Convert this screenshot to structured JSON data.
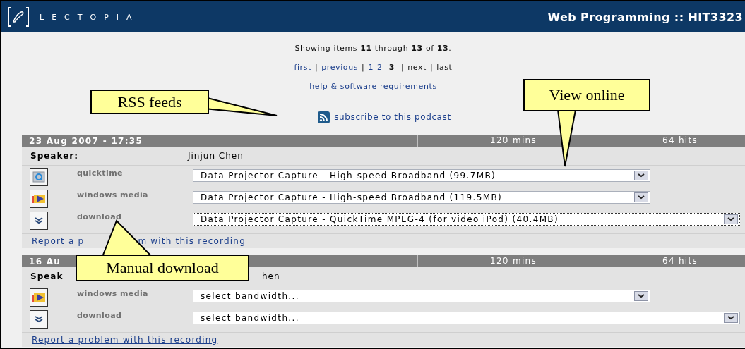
{
  "header": {
    "logo_text": "LECTOPIA",
    "title": "Web Programming :: HIT3323"
  },
  "paging": {
    "summary": "Showing items **11** through **13** of **13**.",
    "items": [
      {
        "text": "first",
        "kind": "link"
      },
      {
        "text": "|",
        "kind": "separator"
      },
      {
        "text": "previous",
        "kind": "link"
      },
      {
        "text": "|",
        "kind": "separator"
      },
      {
        "text": "1",
        "kind": "link"
      },
      {
        "text": "2",
        "kind": "link"
      },
      {
        "text": "3",
        "kind": "current"
      },
      {
        "text": "|",
        "kind": "separator"
      },
      {
        "text": "next",
        "kind": "plain"
      },
      {
        "text": "|",
        "kind": "separator"
      },
      {
        "text": "last",
        "kind": "plain"
      }
    ]
  },
  "help_link": "help & software requirements",
  "subscribe_link": "subscribe to this podcast",
  "recordings": [
    {
      "date": "23 Aug 2007 - 17:35",
      "duration": "120 mins",
      "hits": "64 hits",
      "speaker_label": "Speaker:",
      "speaker": "Jinjun Chen",
      "formats": [
        {
          "kind": "quicktime",
          "label": "quicktime",
          "value": "Data Projector Capture - High-speed Broadband (99.7MB)",
          "focused": false
        },
        {
          "kind": "windows_media",
          "label": "windows media",
          "value": "Data Projector Capture - High-speed Broadband (119.5MB)",
          "focused": false
        },
        {
          "kind": "download",
          "label": "download",
          "value": "Data Projector Capture - QuickTime MPEG-4 (for video iPod) (40.4MB)",
          "focused": true
        }
      ],
      "report": [
        "Report a p",
        "m with this recording"
      ]
    },
    {
      "date": "16 Au",
      "duration": "120 mins",
      "hits": "64 hits",
      "speaker_label": "Speak",
      "speaker": "hen",
      "formats": [
        {
          "kind": "windows_media",
          "label": "windows media",
          "value": "select bandwidth...",
          "focused": false
        },
        {
          "kind": "download",
          "label": "download",
          "value": "select bandwidth...",
          "focused": false
        }
      ],
      "report": [
        "Report a problem with this recording"
      ]
    }
  ],
  "callouts": [
    {
      "text": "RSS feeds",
      "kind": "rss"
    },
    {
      "text": "View online",
      "kind": "online"
    },
    {
      "text": "Manual download",
      "kind": "manual"
    }
  ]
}
